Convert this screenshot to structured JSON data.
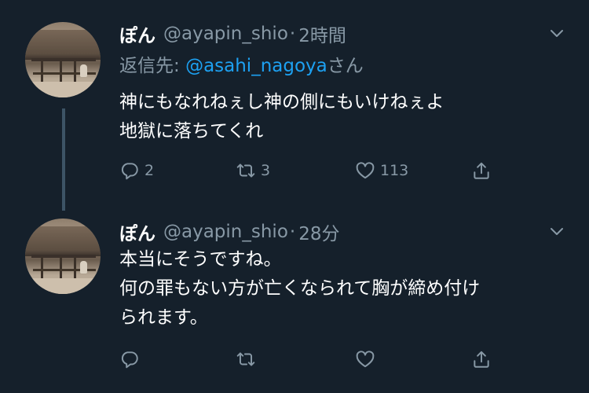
{
  "tweets": [
    {
      "display_name": "ぽん",
      "handle": "@ayapin_shio",
      "separator": "·",
      "time": "2時間",
      "reply_to_prefix": "返信先: ",
      "reply_to_mention": "@asahi_nagoya",
      "reply_to_suffix": "さん",
      "lines": [
        "神にもなれねぇし神の側にもいけねぇよ",
        "地獄に落ちてくれ"
      ],
      "counts": {
        "reply": "2",
        "retweet": "3",
        "like": "113"
      }
    },
    {
      "display_name": "ぽん",
      "handle": "@ayapin_shio",
      "separator": "·",
      "time": "28分",
      "lines": [
        "本当にそうですね。",
        "何の罪もない方が亡くなられて胸が締め付け",
        "られます。"
      ],
      "counts": {
        "reply": "",
        "retweet": "",
        "like": ""
      }
    }
  ],
  "icons": {
    "reply": "reply-icon",
    "retweet": "retweet-icon",
    "like": "heart-icon",
    "share": "share-icon",
    "menu": "chevron-down-icon"
  },
  "colors": {
    "background": "#15202b",
    "secondary_text": "#8899a6",
    "link": "#1da1f2",
    "thread_line": "#3d5466"
  }
}
